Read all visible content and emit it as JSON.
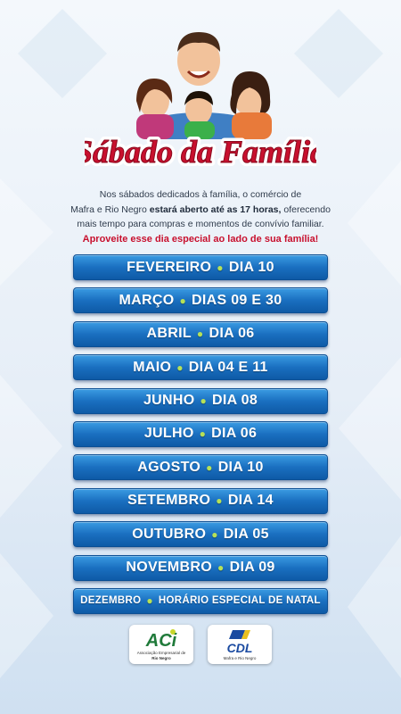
{
  "header": {
    "title": "Sábado da Família"
  },
  "intro": {
    "line1": "Nos sábados dedicados à família, o comércio de",
    "line2_start": "Mafra e Rio Negro ",
    "line2_bold": "estará aberto até as 17 horas,",
    "line2_end": " oferecendo",
    "line3": "mais tempo para compras e momentos de convívio familiar.",
    "highlight": "Aproveite esse dia especial ao lado de sua família!"
  },
  "dates": [
    {
      "month": "FEVEREIRO",
      "day": "DIA 10"
    },
    {
      "month": "MARÇO",
      "day": "DIAS 09 E 30"
    },
    {
      "month": "ABRIL",
      "day": "DIA 06"
    },
    {
      "month": "MAIO",
      "day": "DIA 04 E 11"
    },
    {
      "month": "JUNHO",
      "day": "DIA 08"
    },
    {
      "month": "JULHO",
      "day": "DIA 06"
    },
    {
      "month": "AGOSTO",
      "day": "DIA 10"
    },
    {
      "month": "SETEMBRO",
      "day": "DIA 14"
    },
    {
      "month": "OUTUBRO",
      "day": "DIA 05"
    },
    {
      "month": "NOVEMBRO",
      "day": "DIA 09"
    },
    {
      "month": "DEZEMBRO",
      "day": "HORÁRIO ESPECIAL DE NATAL"
    }
  ],
  "sponsors": {
    "aci": {
      "brand": "ACi",
      "line1": "Associação Empresarial de",
      "line2": "Rio Negro"
    },
    "cdl": {
      "brand": "CDL",
      "line1": "Mafra e Rio Negro"
    }
  },
  "colors": {
    "button_blue": "#1a6fc0",
    "dot_green": "#b6e157",
    "title_red": "#c8102e"
  }
}
